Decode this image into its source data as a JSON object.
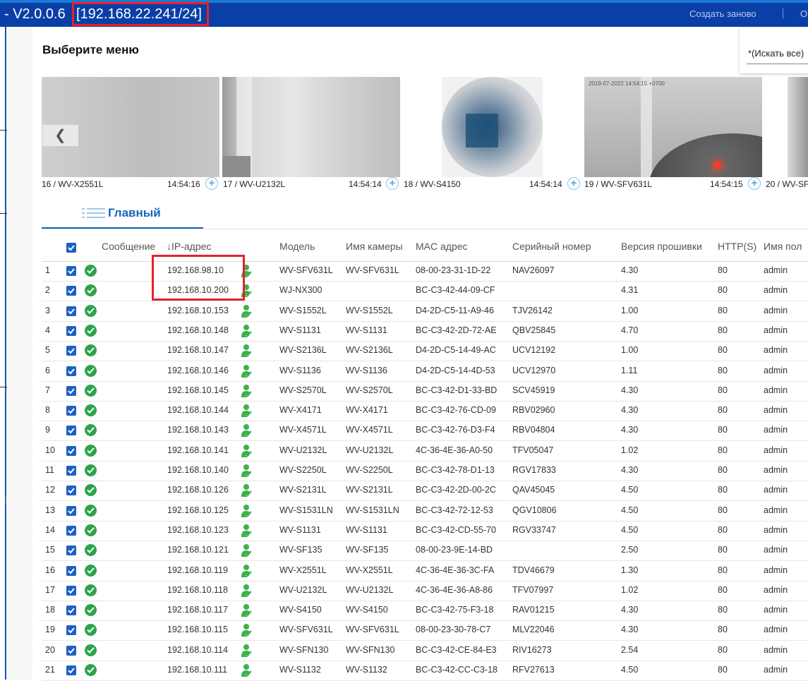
{
  "titlebar": {
    "version": "- V2.0.0.6 ",
    "ip_range": "[192.168.22.241/24]",
    "recreate_label": "Создать заново",
    "more_label": "О"
  },
  "menu": {
    "title": "Выберите меню",
    "search_placeholder": "*(Искать все)"
  },
  "cameras": [
    {
      "caption": "16 / WV-X2551L",
      "time": "14:54:16"
    },
    {
      "caption": "17 / WV-U2132L",
      "time": "14:54:14"
    },
    {
      "caption": "18 / WV-S4150",
      "time": "14:54:14"
    },
    {
      "caption": "19 / WV-SFV631L",
      "time": "14:54:15"
    },
    {
      "caption": "20 / WV-SF",
      "time": ""
    }
  ],
  "thumb4_stamp": "2019-07-2022 14:54:15 +0700",
  "tab": {
    "label": "Главный"
  },
  "table": {
    "headers": {
      "message": "Сообщение",
      "ip": "↓IP-адрес",
      "model": "Модель",
      "camera_name": "Имя камеры",
      "mac": "MAC адрес",
      "serial": "Серийный номер",
      "firmware": "Версия прошивки",
      "http": "HTTP(S)",
      "user": "Имя пол"
    },
    "rows": [
      {
        "n": "1",
        "ip": "192.168.98.10",
        "model": "WV-SFV631L",
        "name": "WV-SFV631L",
        "mac": "08-00-23-31-1D-22",
        "serial": "NAV26097",
        "fw": "4.30",
        "http": "80",
        "user": "admin"
      },
      {
        "n": "2",
        "ip": "192.168.10.200",
        "model": "WJ-NX300",
        "name": "",
        "mac": "BC-C3-42-44-09-CF",
        "serial": "",
        "fw": "4.31",
        "http": "80",
        "user": "admin"
      },
      {
        "n": "3",
        "ip": "192.168.10.153",
        "model": "WV-S1552L",
        "name": "WV-S1552L",
        "mac": "D4-2D-C5-11-A9-46",
        "serial": "TJV26142",
        "fw": "1.00",
        "http": "80",
        "user": "admin"
      },
      {
        "n": "4",
        "ip": "192.168.10.148",
        "model": "WV-S1131",
        "name": "WV-S1131",
        "mac": "BC-C3-42-2D-72-AE",
        "serial": "QBV25845",
        "fw": "4.70",
        "http": "80",
        "user": "admin"
      },
      {
        "n": "5",
        "ip": "192.168.10.147",
        "model": "WV-S2136L",
        "name": "WV-S2136L",
        "mac": "D4-2D-C5-14-49-AC",
        "serial": "UCV12192",
        "fw": "1.00",
        "http": "80",
        "user": "admin"
      },
      {
        "n": "6",
        "ip": "192.168.10.146",
        "model": "WV-S1136",
        "name": "WV-S1136",
        "mac": "D4-2D-C5-14-4D-53",
        "serial": "UCV12970",
        "fw": "1.11",
        "http": "80",
        "user": "admin"
      },
      {
        "n": "7",
        "ip": "192.168.10.145",
        "model": "WV-S2570L",
        "name": "WV-S2570L",
        "mac": "BC-C3-42-D1-33-BD",
        "serial": "SCV45919",
        "fw": "4.30",
        "http": "80",
        "user": "admin"
      },
      {
        "n": "8",
        "ip": "192.168.10.144",
        "model": "WV-X4171",
        "name": "WV-X4171",
        "mac": "BC-C3-42-76-CD-09",
        "serial": "RBV02960",
        "fw": "4.30",
        "http": "80",
        "user": "admin"
      },
      {
        "n": "9",
        "ip": "192.168.10.143",
        "model": "WV-X4571L",
        "name": "WV-X4571L",
        "mac": "BC-C3-42-76-D3-F4",
        "serial": "RBV04804",
        "fw": "4.30",
        "http": "80",
        "user": "admin"
      },
      {
        "n": "10",
        "ip": "192.168.10.141",
        "model": "WV-U2132L",
        "name": "WV-U2132L",
        "mac": "4C-36-4E-36-A0-50",
        "serial": "TFV05047",
        "fw": "1.02",
        "http": "80",
        "user": "admin"
      },
      {
        "n": "11",
        "ip": "192.168.10.140",
        "model": "WV-S2250L",
        "name": "WV-S2250L",
        "mac": "BC-C3-42-78-D1-13",
        "serial": "RGV17833",
        "fw": "4.30",
        "http": "80",
        "user": "admin"
      },
      {
        "n": "12",
        "ip": "192.168.10.126",
        "model": "WV-S2131L",
        "name": "WV-S2131L",
        "mac": "BC-C3-42-2D-00-2C",
        "serial": "QAV45045",
        "fw": "4.50",
        "http": "80",
        "user": "admin"
      },
      {
        "n": "13",
        "ip": "192.168.10.125",
        "model": "WV-S1531LN",
        "name": "WV-S1531LN",
        "mac": "BC-C3-42-72-12-53",
        "serial": "QGV10806",
        "fw": "4.50",
        "http": "80",
        "user": "admin"
      },
      {
        "n": "14",
        "ip": "192.168.10.123",
        "model": "WV-S1131",
        "name": "WV-S1131",
        "mac": "BC-C3-42-CD-55-70",
        "serial": "RGV33747",
        "fw": "4.50",
        "http": "80",
        "user": "admin"
      },
      {
        "n": "15",
        "ip": "192.168.10.121",
        "model": "WV-SF135",
        "name": "WV-SF135",
        "mac": "08-00-23-9E-14-BD",
        "serial": "",
        "fw": "2.50",
        "http": "80",
        "user": "admin"
      },
      {
        "n": "16",
        "ip": "192.168.10.119",
        "model": "WV-X2551L",
        "name": "WV-X2551L",
        "mac": "4C-36-4E-36-3C-FA",
        "serial": "TDV46679",
        "fw": "1.30",
        "http": "80",
        "user": "admin"
      },
      {
        "n": "17",
        "ip": "192.168.10.118",
        "model": "WV-U2132L",
        "name": "WV-U2132L",
        "mac": "4C-36-4E-36-A8-86",
        "serial": "TFV07997",
        "fw": "1.02",
        "http": "80",
        "user": "admin"
      },
      {
        "n": "18",
        "ip": "192.168.10.117",
        "model": "WV-S4150",
        "name": "WV-S4150",
        "mac": "BC-C3-42-75-F3-18",
        "serial": "RAV01215",
        "fw": "4.30",
        "http": "80",
        "user": "admin"
      },
      {
        "n": "19",
        "ip": "192.168.10.115",
        "model": "WV-SFV631L",
        "name": "WV-SFV631L",
        "mac": "08-00-23-30-78-C7",
        "serial": "MLV22046",
        "fw": "4.30",
        "http": "80",
        "user": "admin"
      },
      {
        "n": "20",
        "ip": "192.168.10.114",
        "model": "WV-SFN130",
        "name": "WV-SFN130",
        "mac": "BC-C3-42-CE-84-E3",
        "serial": "RIV16273",
        "fw": "2.54",
        "http": "80",
        "user": "admin"
      },
      {
        "n": "21",
        "ip": "192.168.10.111",
        "model": "WV-S1132",
        "name": "WV-S1132",
        "mac": "BC-C3-42-CC-C3-18",
        "serial": "RFV27613",
        "fw": "4.50",
        "http": "80",
        "user": "admin"
      }
    ]
  },
  "colors": {
    "titlebar": "#0a3fa8",
    "accent": "#1565c0",
    "highlight": "#e8202a",
    "ok": "#2ca44a",
    "person": "#3bb24a"
  },
  "icons": {
    "prev": "chevron-left-icon",
    "zoom": "zoom-in-icon",
    "status": "check-circle-icon",
    "auth": "user-check-icon",
    "tab": "list-icon"
  }
}
